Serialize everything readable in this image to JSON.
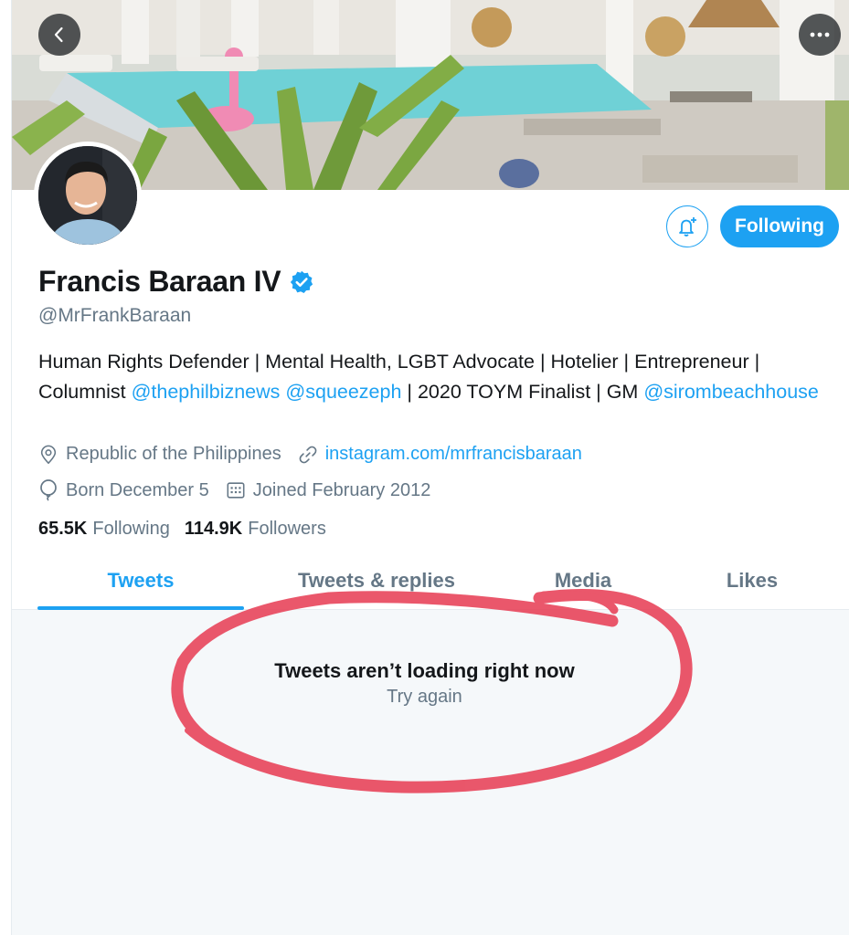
{
  "profile": {
    "name": "Francis Baraan IV",
    "handle": "@MrFrankBaraan",
    "verified": true,
    "bio_parts": [
      {
        "text": "Human Rights Defender | Mental Health, LGBT Advocate | Hotelier | Entrepreneur | Columnist ",
        "type": "text"
      },
      {
        "text": "@thephilbiznews",
        "type": "mention"
      },
      {
        "text": " ",
        "type": "text"
      },
      {
        "text": "@squeezeph",
        "type": "mention"
      },
      {
        "text": " | 2020 TOYM Finalist | GM ",
        "type": "text"
      },
      {
        "text": "@sirombeachhouse",
        "type": "mention"
      }
    ],
    "location": "Republic of the Philippines",
    "website": "instagram.com/mrfrancisbaraan",
    "birthday": "Born December 5",
    "joined": "Joined February 2012",
    "following_count": "65.5K",
    "following_label": "Following",
    "followers_count": "114.9K",
    "followers_label": "Followers"
  },
  "actions": {
    "follow_label": "Following"
  },
  "tabs": [
    {
      "label": "Tweets",
      "active": true
    },
    {
      "label": "Tweets & replies",
      "active": false
    },
    {
      "label": "Media",
      "active": false
    },
    {
      "label": "Likes",
      "active": false
    }
  ],
  "feed": {
    "error_title": "Tweets aren’t loading right now",
    "retry_label": "Try again"
  },
  "colors": {
    "accent": "#1da1f2",
    "secondary_text": "#657786",
    "annotation": "#e8455b"
  },
  "icons": [
    "back-arrow-icon",
    "more-icon",
    "verified-badge-icon",
    "notification-bell-icon",
    "location-icon",
    "link-icon",
    "birthday-balloon-icon",
    "calendar-icon"
  ]
}
